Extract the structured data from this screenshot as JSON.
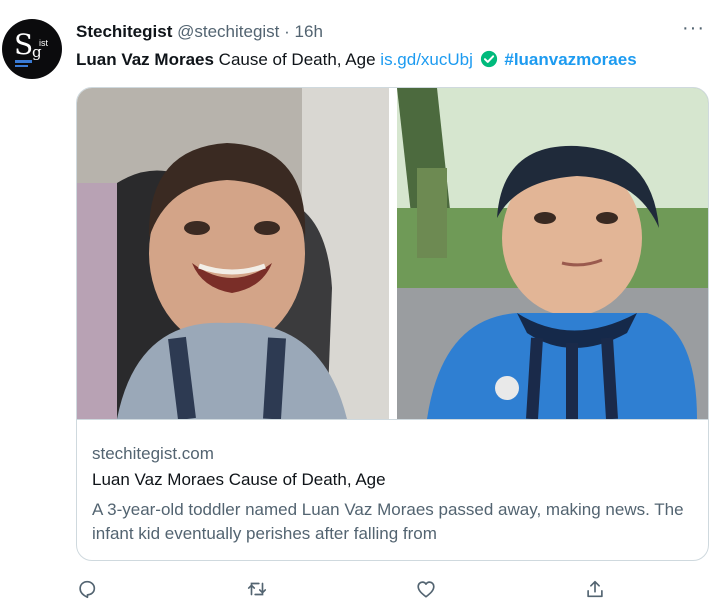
{
  "tweet": {
    "author_name": "Stechitegist",
    "author_handle": "@stechitegist",
    "separator": "·",
    "time": "16h",
    "more_label": "···",
    "avatar_logo": "Sgist",
    "text_bold": "Luan Vaz Moraes",
    "text_plain": "Cause of Death, Age",
    "text_link": "is.gd/xucUbj",
    "text_hashtag": "#luanvazmoraes",
    "check_icon": "check-circle-icon"
  },
  "card": {
    "domain": "stechitegist.com",
    "title": "Luan Vaz Moraes Cause of Death, Age",
    "description": "A 3-year-old toddler named Luan Vaz Moraes passed away, making news. The infant kid eventually perishes after falling from"
  },
  "actions": {
    "icons": [
      "reply-icon",
      "retweet-icon",
      "like-icon",
      "share-icon"
    ]
  },
  "colors": {
    "link": "#1d9bf0",
    "secondary_text": "#536471",
    "check": "#00ba7c",
    "border": "#cfd9de"
  }
}
